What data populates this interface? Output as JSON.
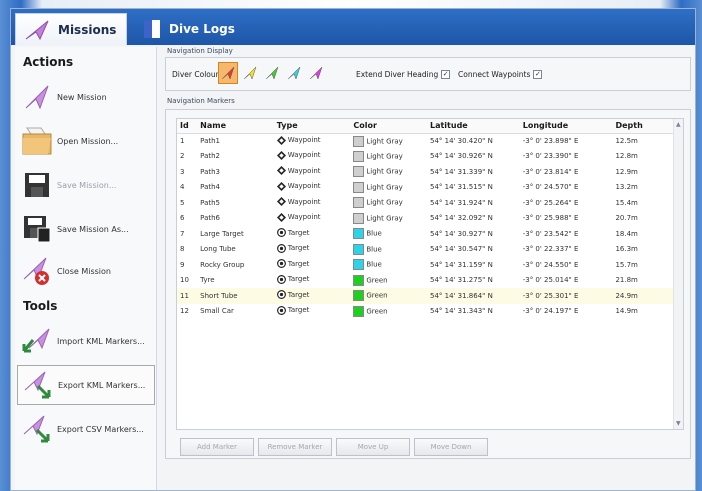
{
  "tabs": [
    {
      "label": "Missions",
      "icon": "mission-flag-icon",
      "active": true
    },
    {
      "label": "Dive Logs",
      "icon": "dive-log-icon",
      "active": false
    }
  ],
  "sidebar": {
    "actions_title": "Actions",
    "actions": [
      {
        "label": "New Mission",
        "icon": "new-mission-icon",
        "disabled": false
      },
      {
        "label": "Open Mission...",
        "icon": "open-folder-icon",
        "disabled": false
      },
      {
        "label": "Save Mission...",
        "icon": "save-disk-icon",
        "disabled": true
      },
      {
        "label": "Save Mission As...",
        "icon": "save-as-disk-icon",
        "disabled": false
      },
      {
        "label": "Close Mission",
        "icon": "close-mission-icon",
        "disabled": false
      }
    ],
    "tools_title": "Tools",
    "tools": [
      {
        "label": "Import KML Markers...",
        "icon": "import-kml-icon",
        "selected": false
      },
      {
        "label": "Export KML Markers...",
        "icon": "export-kml-icon",
        "selected": true
      },
      {
        "label": "Export CSV Markers...",
        "icon": "export-csv-icon",
        "selected": false
      }
    ]
  },
  "nav_display": {
    "group_label": "Navigation Display",
    "diver_colour_label": "Diver Colour",
    "diver_colours": [
      "#e53935",
      "#f1e21a",
      "#3ccf2f",
      "#2fd4d4",
      "#e33be3"
    ],
    "selected_colour_index": 0,
    "extend_heading_label": "Extend Diver Heading",
    "extend_heading_checked": true,
    "connect_waypoints_label": "Connect Waypoints",
    "connect_waypoints_checked": true
  },
  "markers": {
    "group_label": "Navigation Markers",
    "columns": [
      "Id",
      "Name",
      "Type",
      "Color",
      "Latitude",
      "Longitude",
      "Depth"
    ],
    "rows": [
      {
        "id": "1",
        "name": "Path1",
        "type": "Waypoint",
        "color": "Light Gray",
        "lat": "54° 14' 30.420\" N",
        "lon": "-3° 0' 23.898\" E",
        "depth": "12.5m"
      },
      {
        "id": "2",
        "name": "Path2",
        "type": "Waypoint",
        "color": "Light Gray",
        "lat": "54° 14' 30.926\" N",
        "lon": "-3° 0' 23.390\" E",
        "depth": "12.8m"
      },
      {
        "id": "3",
        "name": "Path3",
        "type": "Waypoint",
        "color": "Light Gray",
        "lat": "54° 14' 31.339\" N",
        "lon": "-3° 0' 23.814\" E",
        "depth": "12.9m"
      },
      {
        "id": "4",
        "name": "Path4",
        "type": "Waypoint",
        "color": "Light Gray",
        "lat": "54° 14' 31.515\" N",
        "lon": "-3° 0' 24.570\" E",
        "depth": "13.2m"
      },
      {
        "id": "5",
        "name": "Path5",
        "type": "Waypoint",
        "color": "Light Gray",
        "lat": "54° 14' 31.924\" N",
        "lon": "-3° 0' 25.264\" E",
        "depth": "15.4m"
      },
      {
        "id": "6",
        "name": "Path6",
        "type": "Waypoint",
        "color": "Light Gray",
        "lat": "54° 14' 32.092\" N",
        "lon": "-3° 0' 25.988\" E",
        "depth": "20.7m"
      },
      {
        "id": "7",
        "name": "Large Target",
        "type": "Target",
        "color": "Blue",
        "lat": "54° 14' 30.927\" N",
        "lon": "-3° 0' 23.542\" E",
        "depth": "18.4m"
      },
      {
        "id": "8",
        "name": "Long Tube",
        "type": "Target",
        "color": "Blue",
        "lat": "54° 14' 30.547\" N",
        "lon": "-3° 0' 22.337\" E",
        "depth": "16.3m"
      },
      {
        "id": "9",
        "name": "Rocky Group",
        "type": "Target",
        "color": "Blue",
        "lat": "54° 14' 31.159\" N",
        "lon": "-3° 0' 24.550\" E",
        "depth": "15.7m"
      },
      {
        "id": "10",
        "name": "Tyre",
        "type": "Target",
        "color": "Green",
        "lat": "54° 14' 31.275\" N",
        "lon": "-3° 0' 25.014\" E",
        "depth": "21.8m"
      },
      {
        "id": "11",
        "name": "Short Tube",
        "type": "Target",
        "color": "Green",
        "lat": "54° 14' 31.864\" N",
        "lon": "-3° 0' 25.301\" E",
        "depth": "24.9m"
      },
      {
        "id": "12",
        "name": "Small Car",
        "type": "Target",
        "color": "Green",
        "lat": "54° 14' 31.343\" N",
        "lon": "-3° 0' 24.197\" E",
        "depth": "14.9m"
      }
    ],
    "highlighted_row_index": 10,
    "color_swatches": {
      "Light Gray": "#cfcfcf",
      "Blue": "#2ed3e8",
      "Green": "#1fd11f"
    }
  },
  "buttons": {
    "add_marker": "Add Marker",
    "remove_marker": "Remove Marker",
    "move_up": "Move Up",
    "move_down": "Move Down"
  }
}
